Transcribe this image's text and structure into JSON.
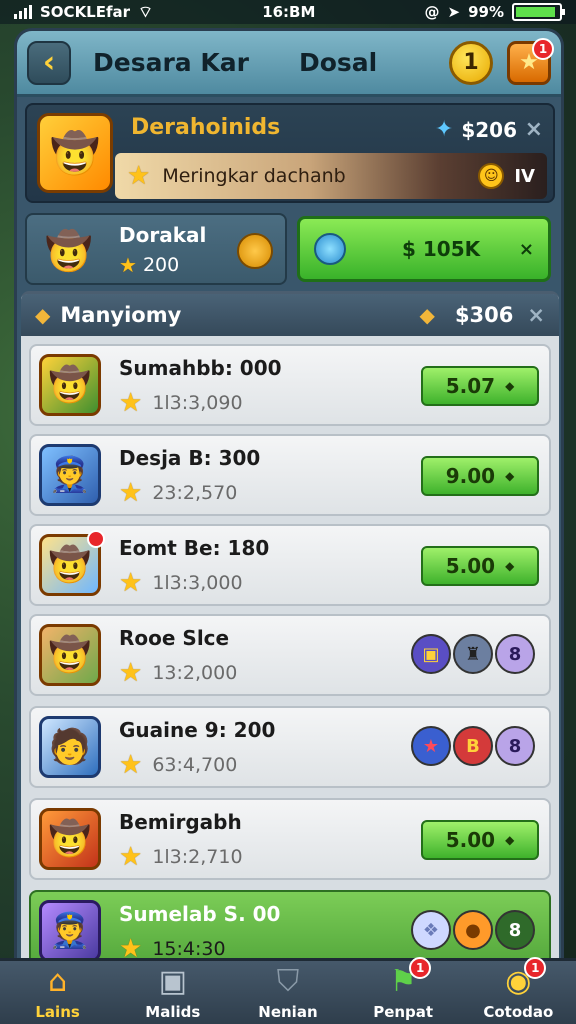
{
  "status": {
    "left": "SOCKLEfar",
    "time": "16:BM",
    "right_icon": "@",
    "battery": "99%"
  },
  "header": {
    "title_left": "Desara Kar",
    "title_right": "Dosal",
    "coin_value": "1",
    "coin_badge": "",
    "star_badge": "1"
  },
  "profile": {
    "name": "Derahoinids",
    "amount": "$206",
    "close": "×",
    "strip_text": "Meringkar dachanb",
    "strip_right": "IV"
  },
  "mid": {
    "card_name": "Dorakal",
    "card_sub": "200",
    "cash_label": "$ 105K",
    "cash_x": "×"
  },
  "list": {
    "title": "Manyiomy",
    "amount": "$306",
    "close": "×",
    "rows": [
      {
        "name": "Sumahbb: 000",
        "sub": "1l3:3,090",
        "price": "5.07"
      },
      {
        "name": "Desja B: 300",
        "sub": "23:2,570",
        "price": "9.00"
      },
      {
        "name": "Eomt Be: 180",
        "sub": "1l3:3,000",
        "price": "5.00"
      },
      {
        "name": "Rooe Slce",
        "sub": "13:2,000",
        "token": "8"
      },
      {
        "name": "Guaine 9: 200",
        "sub": "63:4,700",
        "token_b": "B",
        "token": "8"
      },
      {
        "name": "Bemirgabh",
        "sub": "1l3:2,710",
        "price": "5.00"
      },
      {
        "name": "Sumelab S. 00",
        "sub": "15:4:30",
        "token": "8"
      }
    ]
  },
  "tabs": [
    {
      "label": "Lains",
      "icon": "home-icon"
    },
    {
      "label": "Malids",
      "icon": "cube-icon"
    },
    {
      "label": "Nenian",
      "icon": "shield-icon"
    },
    {
      "label": "Penpat",
      "icon": "flag-icon",
      "badge": "1"
    },
    {
      "label": "Cotodao",
      "icon": "globe-icon",
      "badge": "1"
    }
  ]
}
